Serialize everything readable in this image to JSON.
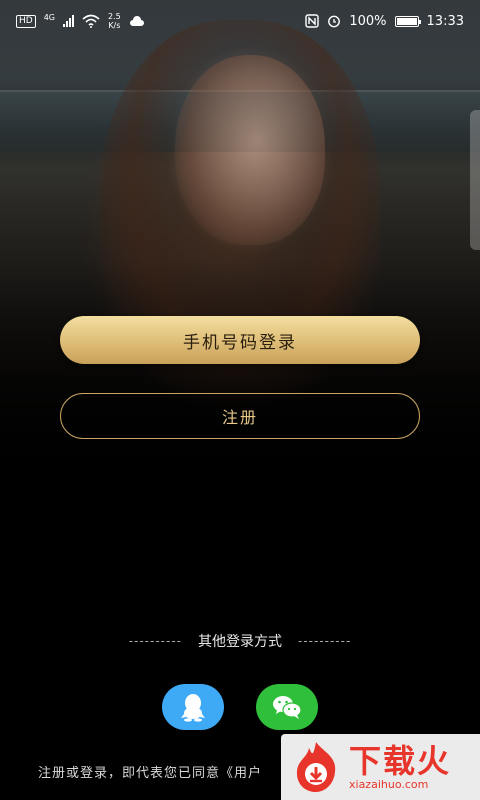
{
  "status_bar": {
    "hd": "HD",
    "network": "4G",
    "speed_value": "2.5",
    "speed_unit": "K/s",
    "battery": "100%",
    "time": "13:33"
  },
  "buttons": {
    "phone_login": "手机号码登录",
    "register": "注册"
  },
  "other_login": {
    "dashes_left": "----------",
    "label": "其他登录方式",
    "dashes_right": "----------"
  },
  "agreement": "注册或登录，即代表您已同意《用户",
  "watermark": {
    "title": "下载火",
    "site": "xiazaihuo.com"
  },
  "colors": {
    "gold_top": "#f3dea0",
    "gold_bottom": "#c9a15a",
    "gold_outline": "#c8a465",
    "qq_blue": "#3ea9f5",
    "wechat_green": "#2fbf3a",
    "watermark_red": "#e8352b"
  }
}
